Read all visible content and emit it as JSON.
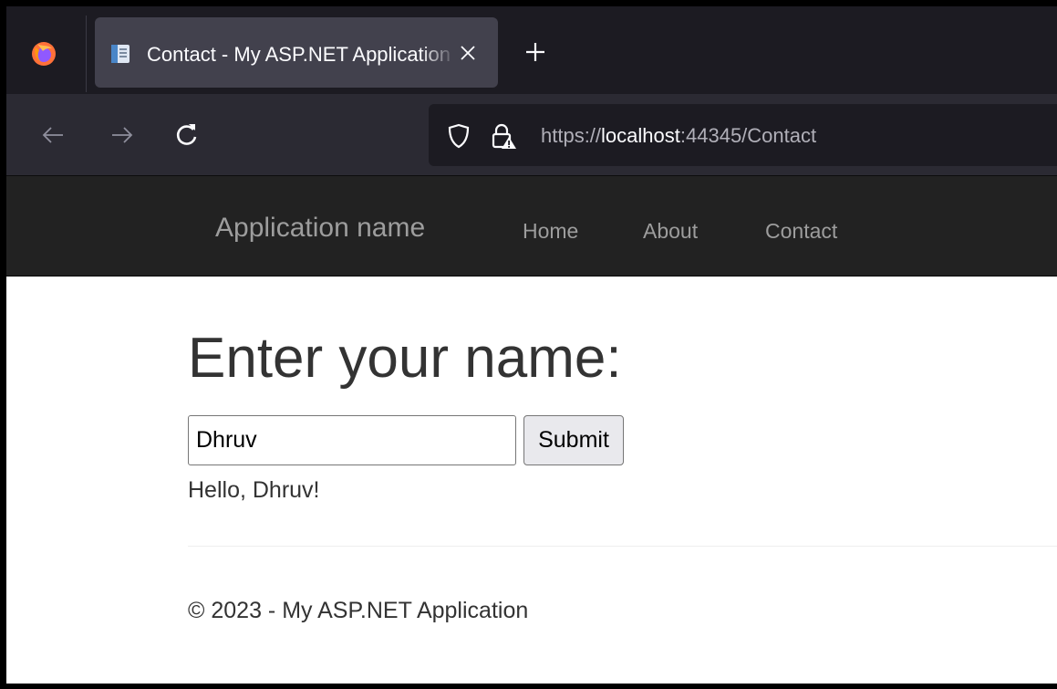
{
  "browser": {
    "tab": {
      "title": "Contact - My ASP.NET Application",
      "close_icon": "close-icon",
      "page_icon": "document-icon"
    },
    "new_tab_icon": "plus-icon",
    "toolbar": {
      "back_icon": "arrow-left-icon",
      "forward_icon": "arrow-right-icon",
      "reload_icon": "reload-icon"
    },
    "url": {
      "scheme": "https://",
      "host": "localhost",
      "rest": ":44345/Contact"
    }
  },
  "site": {
    "brand": "Application name",
    "nav": [
      "Home",
      "About",
      "Contact"
    ]
  },
  "form": {
    "heading": "Enter your name:",
    "input_value": "Dhruv",
    "submit_label": "Submit",
    "greeting": "Hello, Dhruv!"
  },
  "footer": {
    "text": "© 2023 - My ASP.NET Application"
  },
  "colors": {
    "tabstrip": "#1c1b22",
    "active_tab": "#42414d",
    "toolbar": "#2b2a33",
    "navbar": "#222222",
    "nav_text": "#9d9d9d"
  }
}
